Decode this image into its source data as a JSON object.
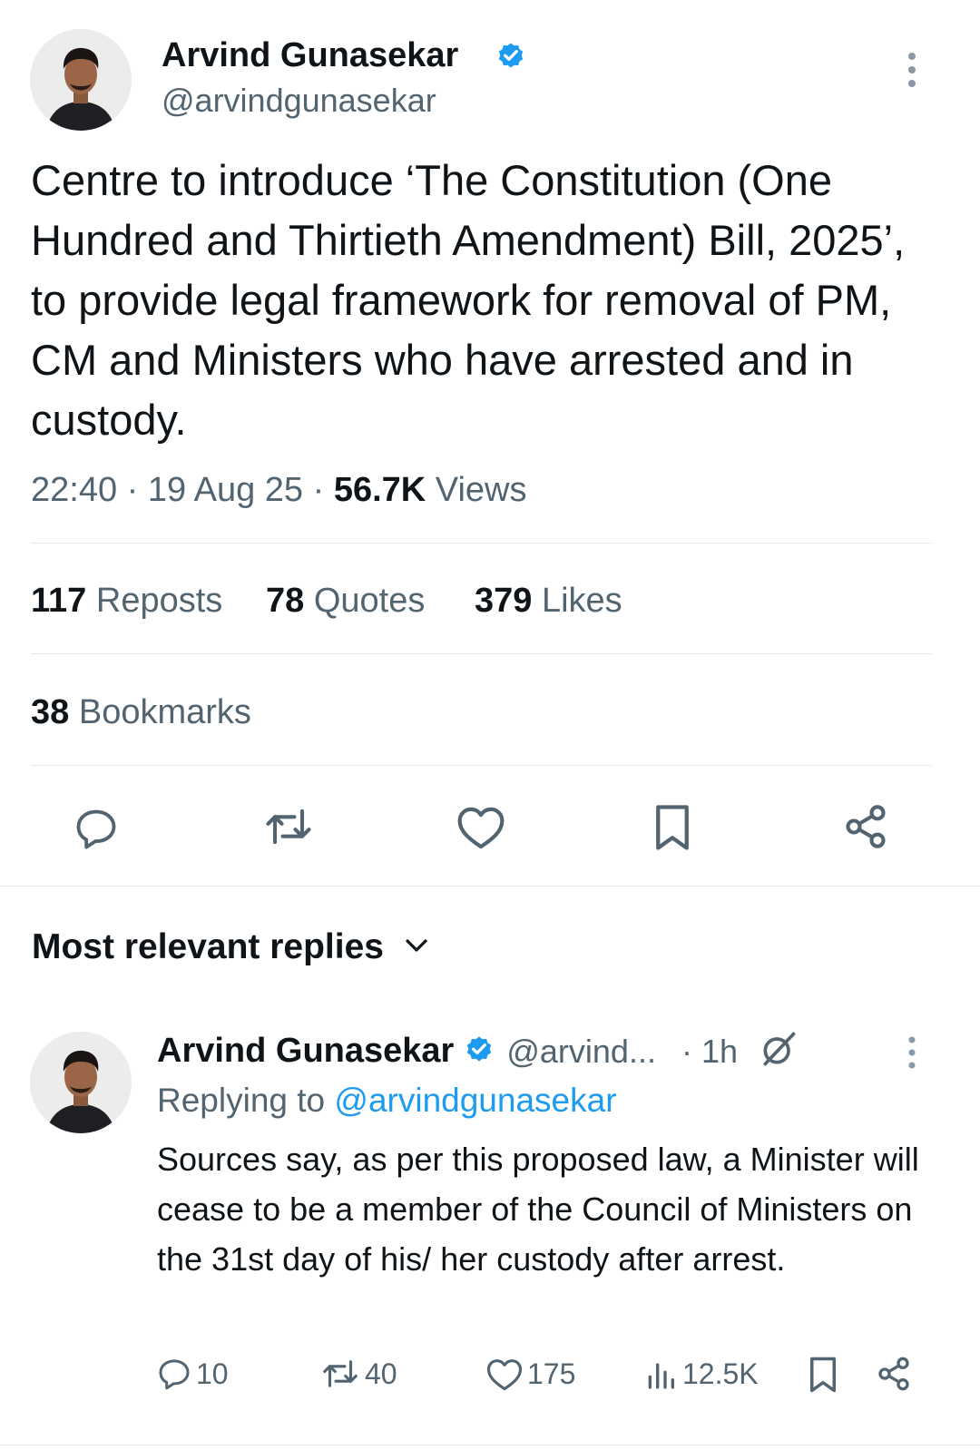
{
  "tweet": {
    "author_name": "Arvind Gunasekar",
    "author_handle": "@arvindgunasekar",
    "text": "Centre to introduce ‘The Constitution (One Hundred and Thirtieth Amendment) Bill, 2025’, to provide legal framework for removal of PM, CM and Ministers who have arrested and in custody.",
    "time": "22:40",
    "date": "19 Aug 25",
    "views_count": "56.7K",
    "views_label": "Views",
    "separator": "·"
  },
  "stats": {
    "reposts_count": "117",
    "reposts_label": "Reposts",
    "quotes_count": "78",
    "quotes_label": "Quotes",
    "likes_count": "379",
    "likes_label": "Likes",
    "bookmarks_count": "38",
    "bookmarks_label": "Bookmarks"
  },
  "actions": [
    "reply-icon",
    "repost-icon",
    "like-icon",
    "bookmark-icon",
    "share-icon"
  ],
  "replies_header": {
    "label": "Most relevant replies"
  },
  "reply": {
    "author_name": "Arvind Gunasekar",
    "author_handle": "@arvind...",
    "time": "· 1h",
    "replying_prefix": "Replying to",
    "replying_handle": "@arvindgunasekar",
    "text": "Sources say, as per this proposed law, a Minister will cease to be a member of the Council of Ministers on the 31st day of his/ her custody after arrest.",
    "replies_count": "10",
    "reposts_count": "40",
    "likes_count": "175",
    "views_count": "12.5K"
  },
  "colors": {
    "verified": "#1d9bf0",
    "link": "#1d9bf0",
    "secondary_text": "#536471",
    "divider": "#e6e9ec"
  }
}
